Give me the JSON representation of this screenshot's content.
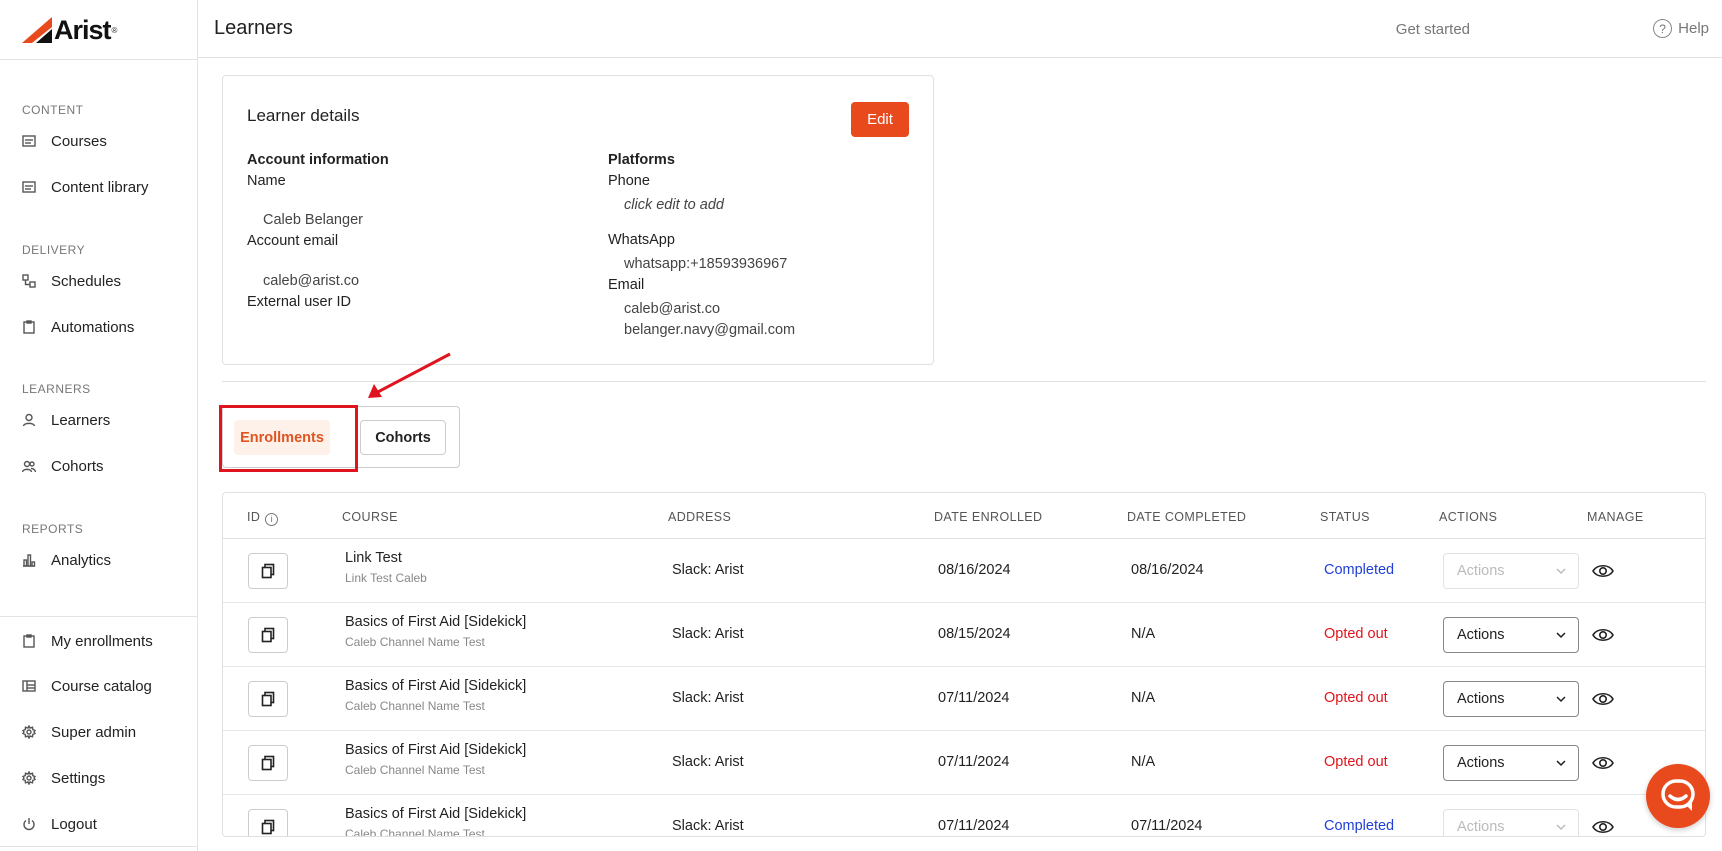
{
  "app": {
    "logo_text": "Arist",
    "logo_reg": "®"
  },
  "sidebar": {
    "sections": [
      {
        "label": "CONTENT",
        "items": [
          {
            "label": "Courses",
            "icon": "courses-icon"
          },
          {
            "label": "Content library",
            "icon": "library-icon"
          }
        ]
      },
      {
        "label": "DELIVERY",
        "items": [
          {
            "label": "Schedules",
            "icon": "schedules-icon"
          },
          {
            "label": "Automations",
            "icon": "automations-icon"
          }
        ]
      },
      {
        "label": "LEARNERS",
        "items": [
          {
            "label": "Learners",
            "icon": "user-icon"
          },
          {
            "label": "Cohorts",
            "icon": "users-icon"
          }
        ]
      },
      {
        "label": "REPORTS",
        "items": [
          {
            "label": "Analytics",
            "icon": "chart-icon"
          }
        ]
      }
    ],
    "bottom_items": [
      {
        "label": "My enrollments",
        "icon": "clipboard-icon"
      },
      {
        "label": "Course catalog",
        "icon": "catalog-icon"
      },
      {
        "label": "Super admin",
        "icon": "gear-icon"
      },
      {
        "label": "Settings",
        "icon": "gear-icon"
      },
      {
        "label": "Logout",
        "icon": "power-icon"
      }
    ]
  },
  "header": {
    "title": "Learners",
    "get_started": "Get started",
    "help": "Help"
  },
  "details": {
    "title": "Learner details",
    "edit_label": "Edit",
    "account_heading": "Account information",
    "name_label": "Name",
    "name_value": "Caleb Belanger",
    "email_label": "Account email",
    "email_value": "caleb@arist.co",
    "external_label": "External user ID",
    "platforms_heading": "Platforms",
    "phone_label": "Phone",
    "phone_value": "click edit to add",
    "whatsapp_label": "WhatsApp",
    "whatsapp_value": "whatsapp:+18593936967",
    "email2_label": "Email",
    "email2_values": [
      "caleb@arist.co",
      "belanger.navy@gmail.com"
    ]
  },
  "tabs": {
    "enrollments": "Enrollments",
    "cohorts": "Cohorts",
    "active": "Enrollments"
  },
  "table": {
    "headers": [
      "ID",
      "COURSE",
      "ADDRESS",
      "DATE ENROLLED",
      "DATE COMPLETED",
      "STATUS",
      "ACTIONS",
      "MANAGE"
    ],
    "actions_label": "Actions",
    "rows": [
      {
        "course": "Link Test",
        "sub": "Link Test Caleb",
        "address": "Slack: Arist",
        "enrolled": "08/16/2024",
        "completed": "08/16/2024",
        "status": "Completed",
        "actions_disabled": true
      },
      {
        "course": "Basics of First Aid [Sidekick]",
        "sub": "Caleb Channel Name Test",
        "address": "Slack: Arist",
        "enrolled": "08/15/2024",
        "completed": "N/A",
        "status": "Opted out",
        "actions_disabled": false
      },
      {
        "course": "Basics of First Aid [Sidekick]",
        "sub": "Caleb Channel Name Test",
        "address": "Slack: Arist",
        "enrolled": "07/11/2024",
        "completed": "N/A",
        "status": "Opted out",
        "actions_disabled": false
      },
      {
        "course": "Basics of First Aid [Sidekick]",
        "sub": "Caleb Channel Name Test",
        "address": "Slack: Arist",
        "enrolled": "07/11/2024",
        "completed": "N/A",
        "status": "Opted out",
        "actions_disabled": false
      },
      {
        "course": "Basics of First Aid [Sidekick]",
        "sub": "Caleb Channel Name Test",
        "address": "Slack: Arist",
        "enrolled": "07/11/2024",
        "completed": "07/11/2024",
        "status": "Completed",
        "actions_disabled": true
      }
    ]
  },
  "colors": {
    "accent": "#e8491d",
    "completed": "#1f3fd6",
    "opted_out": "#e0141e",
    "annotation": "#e0141e"
  }
}
